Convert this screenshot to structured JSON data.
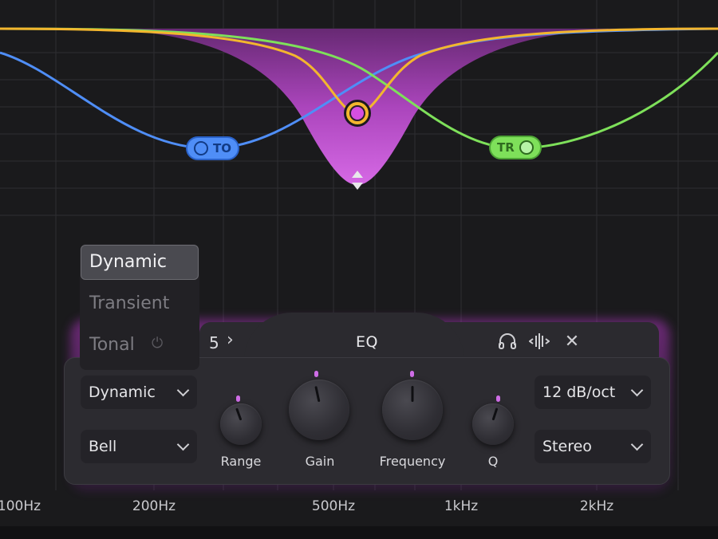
{
  "eq_display": {
    "nodes": [
      {
        "id": "to",
        "label": "TO",
        "color": "#4f8ef7"
      },
      {
        "id": "center",
        "color": "#d54fe2",
        "ring_color": "#f3b62e"
      },
      {
        "id": "tr",
        "label": "TR",
        "color": "#7ee05a"
      }
    ],
    "curve_colors": {
      "blue": "#4f8ef7",
      "yellow": "#f3b62e",
      "green": "#7ee05a",
      "fill": "#c94fd8"
    },
    "freq_axis": [
      "100Hz",
      "200Hz",
      "500Hz",
      "1kHz",
      "2kHz"
    ]
  },
  "dropdown": {
    "options": [
      "Dynamic",
      "Transient",
      "Tonal"
    ],
    "selected": "Dynamic"
  },
  "panel": {
    "band_number": "5",
    "title": "EQ",
    "mode_select": "Dynamic",
    "shape_select": "Bell",
    "slope_select": "12 dB/oct",
    "stereo_select": "Stereo",
    "knobs": [
      {
        "id": "range",
        "label": "Range"
      },
      {
        "id": "gain",
        "label": "Gain"
      },
      {
        "id": "frequency",
        "label": "Frequency"
      },
      {
        "id": "q",
        "label": "Q"
      }
    ],
    "accent": "#cf6de6"
  }
}
